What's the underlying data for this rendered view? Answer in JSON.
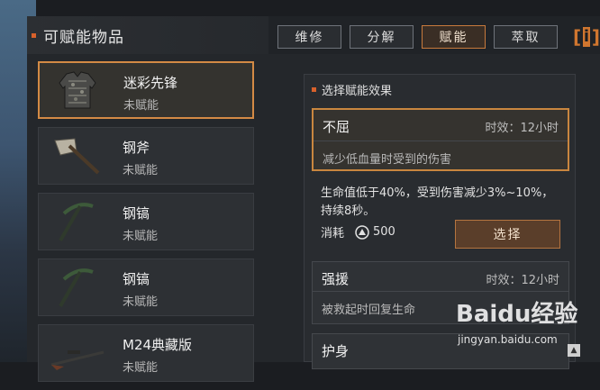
{
  "header": {
    "title": "可赋能物品"
  },
  "tabs": [
    {
      "label": "维修",
      "active": false
    },
    {
      "label": "分解",
      "active": false
    },
    {
      "label": "赋能",
      "active": true
    },
    {
      "label": "萃取",
      "active": false
    }
  ],
  "info_button": {
    "label": "i"
  },
  "items": [
    {
      "name": "迷彩先锋",
      "status": "未赋能",
      "icon": "armor-vest-icon",
      "selected": true
    },
    {
      "name": "钢斧",
      "status": "未赋能",
      "icon": "axe-icon",
      "selected": false
    },
    {
      "name": "钢镐",
      "status": "未赋能",
      "icon": "pickaxe-icon",
      "selected": false
    },
    {
      "name": "钢镐",
      "status": "未赋能",
      "icon": "pickaxe-icon",
      "selected": false
    },
    {
      "name": "M24典藏版",
      "status": "未赋能",
      "icon": "sniper-rifle-icon",
      "selected": false
    }
  ],
  "effects_panel": {
    "title": "选择赋能效果",
    "cards": [
      {
        "name": "不屈",
        "time": "时效：12小时",
        "desc": "减少低血量时受到的伤害",
        "selected": true
      },
      {
        "name": "强援",
        "time": "时效：12小时",
        "desc": "被救起时回复生命",
        "selected": false
      },
      {
        "name": "护身",
        "time": "",
        "desc": "",
        "selected": false
      }
    ],
    "detail": "生命值低于40%，受到伤害减少3%~10%，持续8秒。",
    "cost_label": "消耗",
    "cost_value": "500",
    "select_button": "选择"
  },
  "watermark": {
    "logo": "Baidu经验",
    "url": "jingyan.baidu.com"
  },
  "colors": {
    "accent": "#d38a45",
    "marker": "#d8612b"
  }
}
